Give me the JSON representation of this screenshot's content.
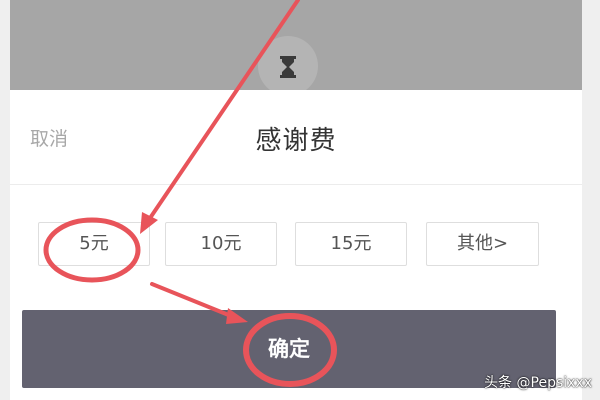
{
  "dialog": {
    "cancel_label": "取消",
    "title": "感谢费"
  },
  "amount_options": {
    "options": [
      "5元",
      "10元",
      "15元",
      "其他>"
    ],
    "highlighted": "5元"
  },
  "confirm": {
    "label": "确定"
  },
  "watermark": {
    "text": "头条 @Pepsixxx"
  },
  "icons": {
    "top_icon": "hourglass-icon"
  },
  "colors": {
    "overlay": "#a6a6a6",
    "confirm_button": "#636270",
    "annotation": "#e8545a"
  }
}
